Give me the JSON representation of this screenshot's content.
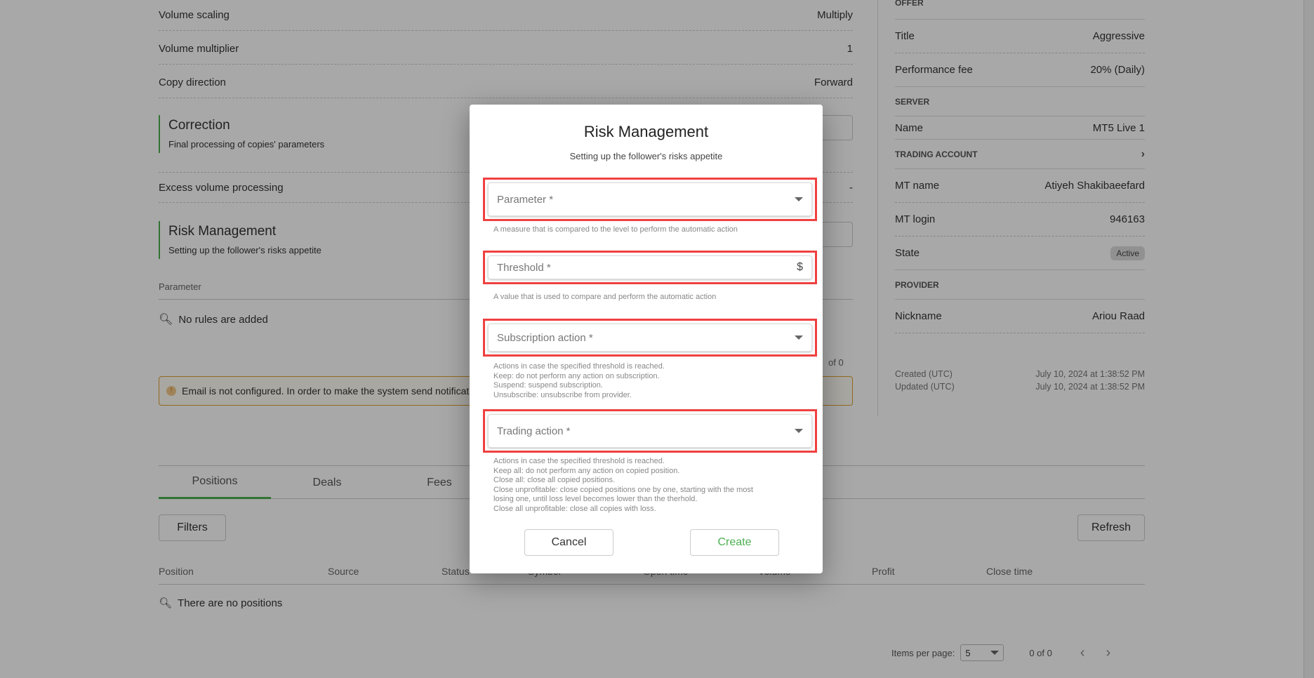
{
  "settings": [
    {
      "label": "Volume scaling",
      "value": "Multiply"
    },
    {
      "label": "Volume multiplier",
      "value": "1"
    },
    {
      "label": "Copy direction",
      "value": "Forward"
    }
  ],
  "correction": {
    "title": "Correction",
    "subtitle": "Final processing of copies' parameters"
  },
  "excess": {
    "label": "Excess volume processing",
    "value": "-"
  },
  "risk": {
    "title": "Risk Management",
    "subtitle": "Setting up the follower's risks appetite",
    "column": "Parameter",
    "empty": "No rules are added",
    "paging": "of 0"
  },
  "warning": "Email is not configured. In order to make the system send notificat",
  "tabs": [
    "Positions",
    "Deals",
    "Fees"
  ],
  "toolbar": {
    "filters": "Filters",
    "refresh": "Refresh"
  },
  "table": {
    "columns": [
      "Position",
      "Source",
      "Status",
      "Symbol",
      "Open time",
      "Volume",
      "Profit",
      "Close time"
    ],
    "empty": "There are no positions"
  },
  "pagination": {
    "label": "Items per page:",
    "per_page": "5",
    "range": "0 of 0"
  },
  "right": {
    "offer": {
      "header": "OFFER",
      "title_label": "Title",
      "title": "Aggressive",
      "fee_label": "Performance fee",
      "fee": "20% (Daily)"
    },
    "server": {
      "header": "SERVER",
      "name_label": "Name",
      "name": "MT5 Live 1"
    },
    "account": {
      "header": "TRADING ACCOUNT",
      "mt_name_label": "MT name",
      "mt_name": "Atiyeh Shakibaeefard",
      "mt_login_label": "MT login",
      "mt_login": "946163",
      "state_label": "State",
      "state": "Active"
    },
    "provider": {
      "header": "PROVIDER",
      "nickname_label": "Nickname",
      "nickname": "Ariou Raad"
    },
    "created_label": "Created (UTC)",
    "created": "July 10, 2024 at 1:38:52 PM",
    "updated_label": "Updated (UTC)",
    "updated": "July 10, 2024 at 1:38:52 PM"
  },
  "modal": {
    "title": "Risk Management",
    "subtitle": "Setting up the follower's risks appetite",
    "parameter": {
      "placeholder": "Parameter *",
      "hint": "A measure that is compared to the level to perform the automatic action"
    },
    "threshold": {
      "placeholder": "Threshold *",
      "suffix": "$",
      "hint": "A value that is used to compare and perform the automatic action"
    },
    "subscription": {
      "placeholder": "Subscription action *",
      "hints": [
        "Actions in case the specified threshold is reached.",
        "Keep: do not perform any action on subscription.",
        "Suspend: suspend subscription.",
        "Unsubscribe: unsubscribe from provider."
      ]
    },
    "trading": {
      "placeholder": "Trading action *",
      "hints": [
        "Actions in case the specified threshold is reached.",
        "Keep all: do not perform any action on copied position.",
        "Close all: close all copied positions.",
        "Close unprofitable: close copied positions one by one, starting with the most",
        "losing one, until loss level becomes lower than the therhold.",
        "Close all unprofitable: close all copies with loss."
      ]
    },
    "cancel": "Cancel",
    "create": "Create"
  },
  "colors": {
    "accent": "#4caf50",
    "highlight": "#f04040",
    "warning": "#e0a030"
  }
}
